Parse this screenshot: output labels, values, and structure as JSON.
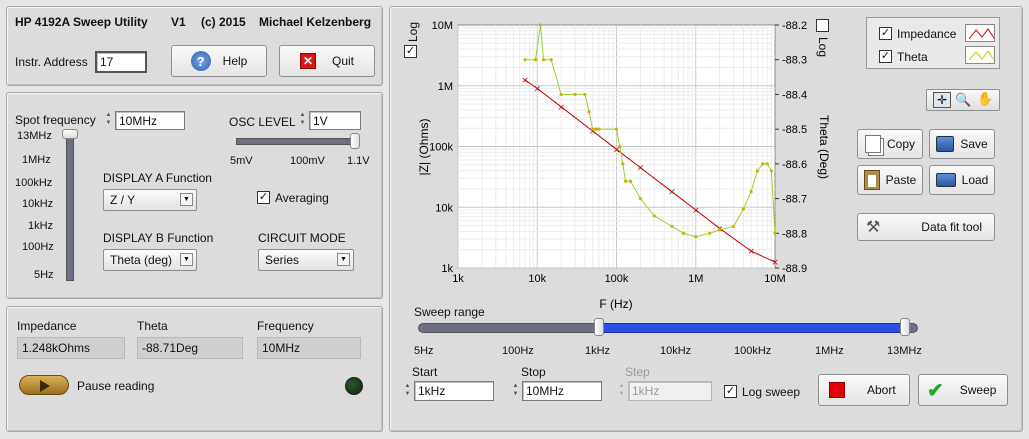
{
  "header": {
    "title": "HP 4192A Sweep Utility",
    "version": "V1",
    "copyright": "(c) 2015",
    "author": "Michael Kelzenberg",
    "instr_address_label": "Instr. Address",
    "instr_address_value": "17",
    "help_label": "Help",
    "quit_label": "Quit"
  },
  "settings": {
    "spot_frequency_label": "Spot frequency",
    "spot_frequency_value": "10MHz",
    "spot_slider_ticks": [
      "13MHz",
      "1MHz",
      "100kHz",
      "10kHz",
      "1kHz",
      "100Hz",
      "5Hz"
    ],
    "osc_level_label": "OSC LEVEL",
    "osc_level_value": "1V",
    "osc_ticks": [
      "5mV",
      "100mV",
      "1.1V"
    ],
    "display_a_label": "DISPLAY A Function",
    "display_a_value": "Z / Y",
    "display_b_label": "DISPLAY B Function",
    "display_b_value": "Theta (deg)",
    "averaging_label": "Averaging",
    "averaging_checked": true,
    "circuit_mode_label": "CIRCUIT MODE",
    "circuit_mode_value": "Series"
  },
  "readout": {
    "impedance_label": "Impedance",
    "impedance_value": "1.248kOhms",
    "theta_label": "Theta",
    "theta_value": "-88.71Deg",
    "frequency_label": "Frequency",
    "frequency_value": "10MHz",
    "pause_label": "Pause reading"
  },
  "plot": {
    "log_left_label": "Log",
    "log_left_checked": true,
    "log_right_label": "Log",
    "log_right_checked": false,
    "legend": [
      {
        "name": "Impedance",
        "color": "#c00000"
      },
      {
        "name": "Theta",
        "color": "#c8c800"
      }
    ],
    "copy_label": "Copy",
    "save_label": "Save",
    "paste_label": "Paste",
    "load_label": "Load",
    "data_fit_label": "Data fit tool",
    "sweep_range_label": "Sweep range",
    "sweep_ticks": [
      "5Hz",
      "100Hz",
      "1kHz",
      "10kHz",
      "100kHz",
      "1MHz",
      "13MHz"
    ],
    "start_label": "Start",
    "start_value": "1kHz",
    "stop_label": "Stop",
    "stop_value": "10MHz",
    "step_label": "Step",
    "step_value": "1kHz",
    "log_sweep_label": "Log sweep",
    "log_sweep_checked": true,
    "abort_label": "Abort",
    "sweep_label": "Sweep"
  },
  "chart_data": {
    "type": "line",
    "xlabel": "F (Hz)",
    "ylabel": "|Z| (Ohms)",
    "y2label": "Theta (Deg)",
    "x_scale": "log",
    "y_scale": "log",
    "xlim": [
      1000,
      10000000
    ],
    "ylim": [
      1000,
      10000000
    ],
    "y2lim": [
      -88.9,
      -88.2
    ],
    "x_ticks": [
      "1k",
      "10k",
      "100k",
      "1M",
      "10M"
    ],
    "y_ticks": [
      "1k",
      "10k",
      "100k",
      "1M",
      "10M"
    ],
    "y2_ticks": [
      "-88.2",
      "-88.3",
      "-88.4",
      "-88.5",
      "-88.6",
      "-88.7",
      "-88.8",
      "-88.9"
    ],
    "grid": true,
    "series": [
      {
        "name": "Impedance",
        "axis": "left",
        "color": "#c00000",
        "x": [
          7000,
          10000,
          20000,
          50000,
          100000,
          200000,
          500000,
          1000000,
          2000000,
          5000000,
          10000000
        ],
        "y": [
          1250000,
          900000,
          450000,
          180000,
          90000,
          45000,
          18000,
          9000,
          4500,
          1900,
          1250
        ]
      },
      {
        "name": "Theta",
        "axis": "right",
        "color": "#c8c800",
        "x": [
          7000,
          9500,
          11000,
          12000,
          15000,
          20000,
          30000,
          40000,
          45000,
          50000,
          55000,
          60000,
          100000,
          110000,
          120000,
          130000,
          150000,
          200000,
          300000,
          500000,
          700000,
          1000000,
          1500000,
          2000000,
          3000000,
          4000000,
          5000000,
          6000000,
          7000000,
          8000000,
          9000000,
          10000000
        ],
        "y": [
          -88.3,
          -88.3,
          -88.2,
          -88.3,
          -88.3,
          -88.4,
          -88.4,
          -88.4,
          -88.45,
          -88.5,
          -88.5,
          -88.5,
          -88.5,
          -88.55,
          -88.6,
          -88.65,
          -88.65,
          -88.7,
          -88.75,
          -88.78,
          -88.8,
          -88.81,
          -88.8,
          -88.79,
          -88.78,
          -88.73,
          -88.68,
          -88.62,
          -88.6,
          -88.6,
          -88.62,
          -88.8
        ]
      }
    ]
  }
}
